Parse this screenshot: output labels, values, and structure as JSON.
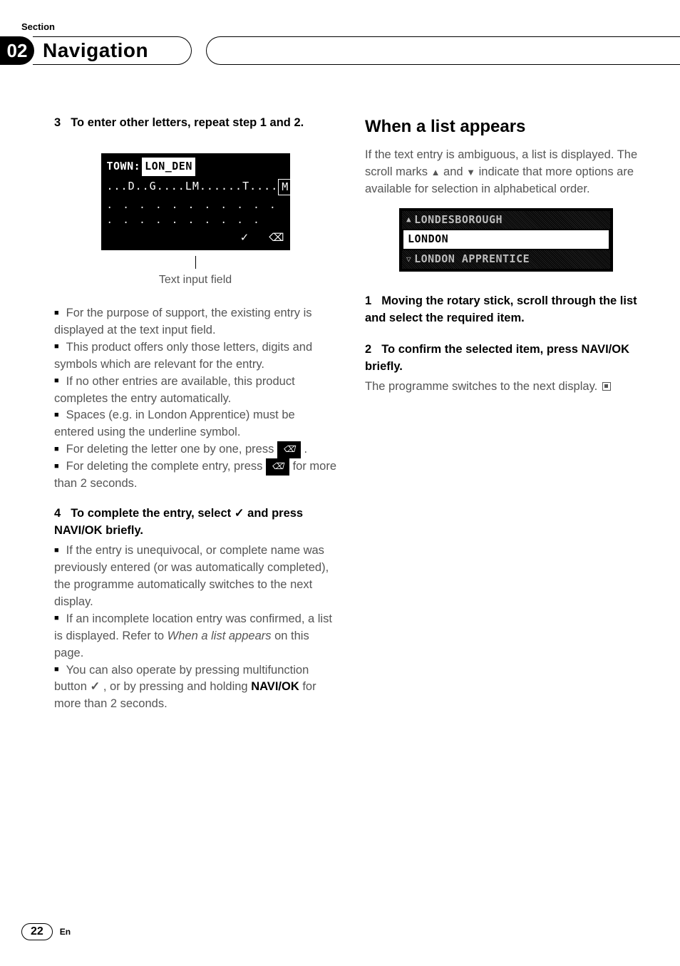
{
  "header": {
    "section_label": "Section",
    "section_number": "02",
    "title": "Navigation"
  },
  "left": {
    "step3_title_num": "3",
    "step3_title": "To enter other letters, repeat step 1 and 2.",
    "screen": {
      "row1_label": "TOWN:",
      "row1_value": "LON_DEN",
      "row2_letters": "...D..G....LM......T....",
      "row2_m": "M",
      "row3_dots": ". . . . . . . . . . . . . . . . . . . . .",
      "row4_check": "✓",
      "row4_eraser": "⌫"
    },
    "caption": "Text input field",
    "bullets3": [
      "For the purpose of support, the existing entry is displayed at the text input field.",
      "This product offers only those letters, digits and symbols which are relevant for the entry.",
      "If no other entries are available, this product completes the entry automatically.",
      "Spaces (e.g. in London Apprentice) must be entered using the underline symbol.",
      "For deleting the letter one by one, press",
      "For deleting the complete entry, press",
      "for more than 2 seconds."
    ],
    "step4_num": "4",
    "step4_title_a": "To complete the entry, select",
    "step4_title_b": "and press NAVI/OK briefly.",
    "bullets4": [
      "If the entry is unequivocal, or complete name was previously entered (or was automatically completed), the programme automatically switches to the next display.",
      "If an incomplete location entry was confirmed, a list is displayed. Refer to",
      "When a list appears",
      "on this page.",
      "You can also operate by pressing multifunction button",
      ", or by pressing and holding",
      "NAVI/OK",
      "for more than 2 seconds."
    ]
  },
  "right": {
    "heading": "When a list appears",
    "para1_a": "If the text entry is ambiguous, a list is displayed. The scroll marks ",
    "para1_b": " and ",
    "para1_c": " indicate that more options are available for selection in alphabetical order.",
    "list": {
      "item1": "LONDESBOROUGH",
      "item2": "LONDON",
      "item3": "LONDON APPRENTICE"
    },
    "step1_num": "1",
    "step1": "Moving the rotary stick, scroll through the list and select the required item.",
    "step2_num": "2",
    "step2": "To confirm the selected item, press NAVI/OK briefly.",
    "step2_para": "The programme switches to the next display."
  },
  "footer": {
    "page": "22",
    "lang": "En"
  }
}
